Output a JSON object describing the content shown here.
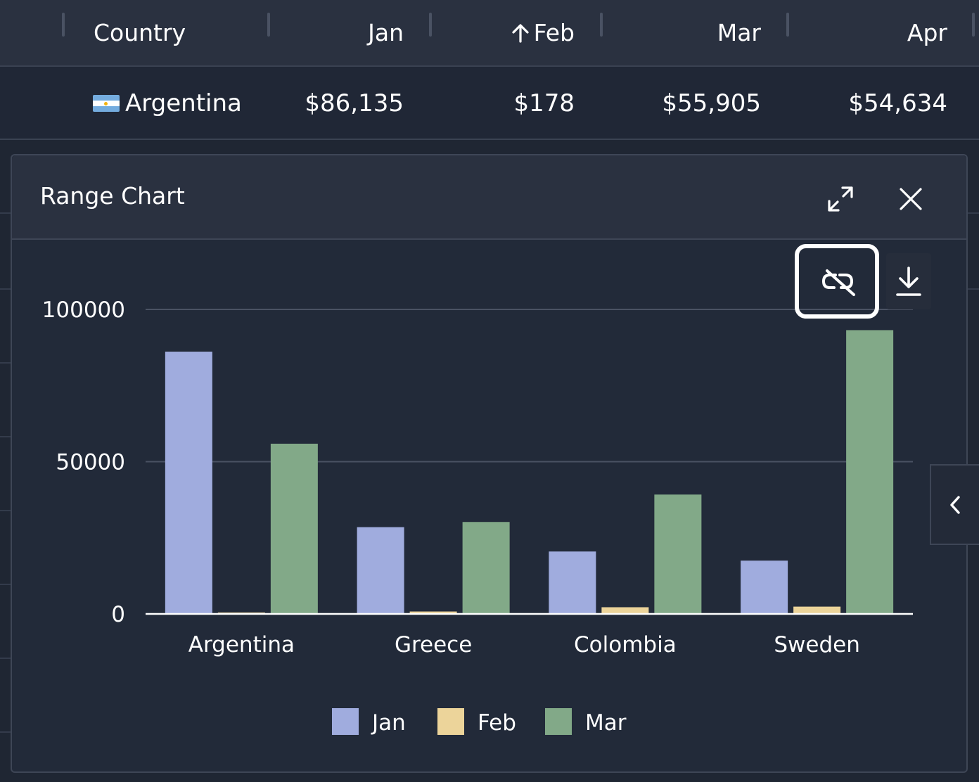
{
  "grid": {
    "columns": [
      {
        "key": "country",
        "label": "Country"
      },
      {
        "key": "jan",
        "label": "Jan"
      },
      {
        "key": "feb",
        "label": "Feb",
        "sorted": "asc"
      },
      {
        "key": "mar",
        "label": "Mar"
      },
      {
        "key": "apr",
        "label": "Apr"
      }
    ],
    "row": {
      "country": "Argentina",
      "jan": "$86,135",
      "feb": "$178",
      "mar": "$55,905",
      "apr": "$54,634"
    }
  },
  "panel": {
    "title": "Range Chart",
    "expand_icon": "expand-icon",
    "close_icon": "close-icon",
    "unlink_icon": "unlink-icon",
    "download_icon": "download-icon",
    "side_tab_icon": "chevron-left-icon"
  },
  "chart_data": {
    "type": "bar",
    "categories": [
      "Argentina",
      "Greece",
      "Colombia",
      "Sweden"
    ],
    "series": [
      {
        "name": "Jan",
        "color": "#a0acde",
        "values": [
          86135,
          28500,
          20500,
          17500
        ]
      },
      {
        "name": "Feb",
        "color": "#ecd49a",
        "values": [
          178,
          800,
          2200,
          2400
        ]
      },
      {
        "name": "Mar",
        "color": "#82a988",
        "values": [
          55905,
          30200,
          39200,
          93200
        ]
      }
    ],
    "yticks": [
      "0",
      "50000",
      "100000"
    ],
    "ylim": [
      0,
      100000
    ],
    "grid": true,
    "legend_position": "bottom"
  }
}
